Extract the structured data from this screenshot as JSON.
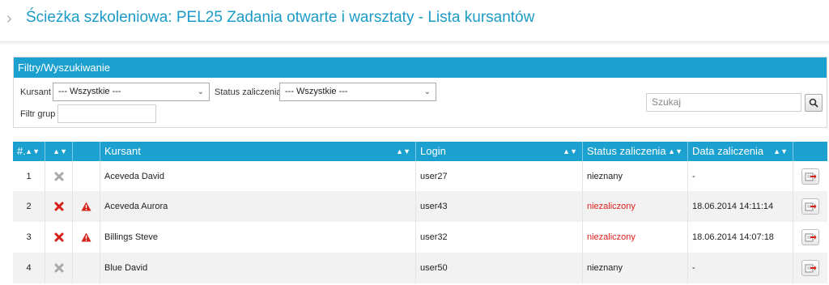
{
  "header": {
    "title": "Ścieżka szkoleniowa: PEL25 Zadania otwarte i warsztaty - Lista kursantów"
  },
  "filters": {
    "panel_title": "Filtry/Wyszukiwanie",
    "kursant_label": "Kursant",
    "kursant_value": "--- Wszystkie ---",
    "status_label": "Status zaliczenia",
    "status_value": "--- Wszystkie ---",
    "group_label": "Filtr grup",
    "group_value": "",
    "search_placeholder": "Szukaj"
  },
  "table": {
    "columns": [
      "#.",
      "",
      "",
      "Kursant",
      "Login",
      "Status zaliczenia",
      "Data zaliczenia",
      ""
    ],
    "rows": [
      {
        "num": "1",
        "removed_active": false,
        "warning": false,
        "name": "Aceveda David",
        "login": "user27",
        "status": "nieznany",
        "status_type": "unknown",
        "date": "-"
      },
      {
        "num": "2",
        "removed_active": true,
        "warning": true,
        "name": "Aceveda Aurora",
        "login": "user43",
        "status": "niezaliczony",
        "status_type": "fail",
        "date": "18.06.2014 14:11:14"
      },
      {
        "num": "3",
        "removed_active": true,
        "warning": true,
        "name": "Billings Steve",
        "login": "user32",
        "status": "niezaliczony",
        "status_type": "fail",
        "date": "18.06.2014 14:07:18"
      },
      {
        "num": "4",
        "removed_active": false,
        "warning": false,
        "name": "Blue David",
        "login": "user50",
        "status": "nieznany",
        "status_type": "unknown",
        "date": "-"
      }
    ]
  },
  "colors": {
    "accent": "#1ba0cf",
    "title": "#1b9bc7",
    "fail": "#e0201b",
    "row_alt": "#f2f2f2"
  },
  "icons": {
    "remove": "x-icon",
    "warning": "warning-triangle-icon",
    "action": "export-icon",
    "search": "magnifier-icon",
    "sort": "sort-arrows-icon"
  }
}
